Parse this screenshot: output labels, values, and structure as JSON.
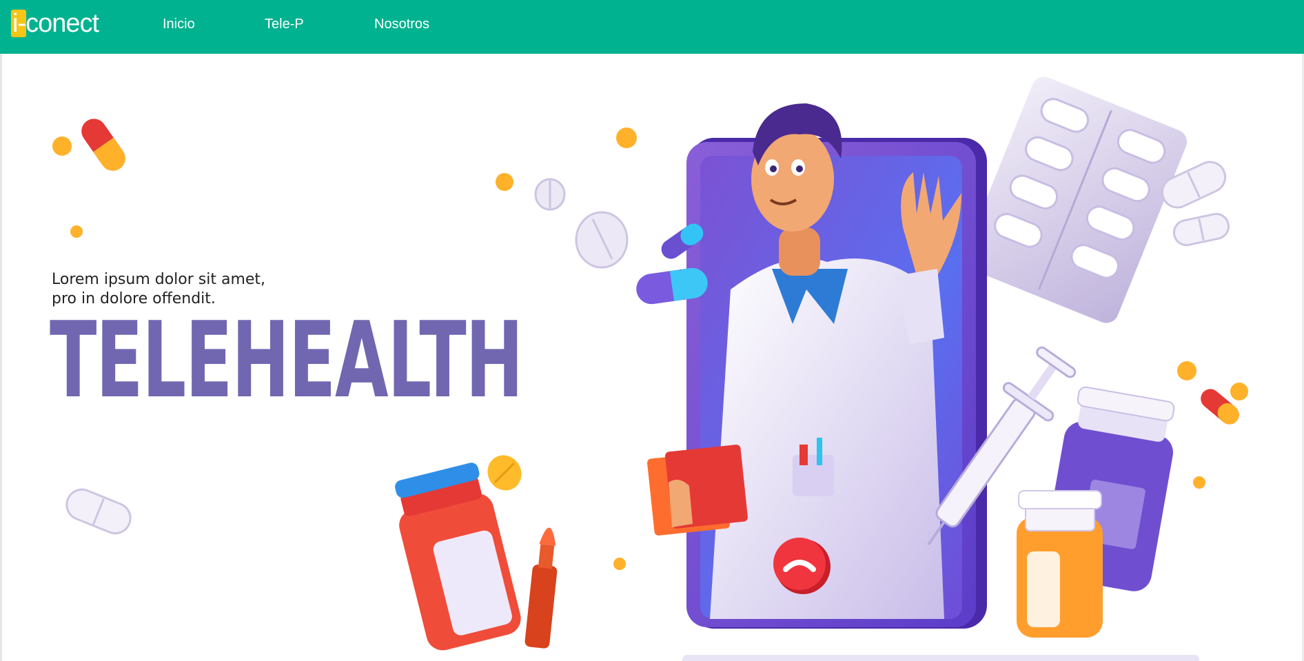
{
  "brand": {
    "logo_text": "i-conect",
    "accent": "#00b290",
    "logo_badge": "#f5c518"
  },
  "nav": {
    "items": [
      {
        "label": "Inicio"
      },
      {
        "label": "Tele-P"
      },
      {
        "label": "Nosotros"
      }
    ]
  },
  "hero": {
    "subtitle_line1": "Lorem ipsum dolor sit amet,",
    "subtitle_line2": "pro in dolore offendit.",
    "headline": "TELEHEALTH",
    "headline_color": "#7067b0"
  },
  "illustration": {
    "description_icons": [
      "doctor-illustration",
      "phone-frame",
      "pill-icon",
      "medicine-bottle-icon",
      "syringe-icon",
      "blister-pack-icon",
      "hang-up-icon",
      "clipboard-icon"
    ]
  }
}
